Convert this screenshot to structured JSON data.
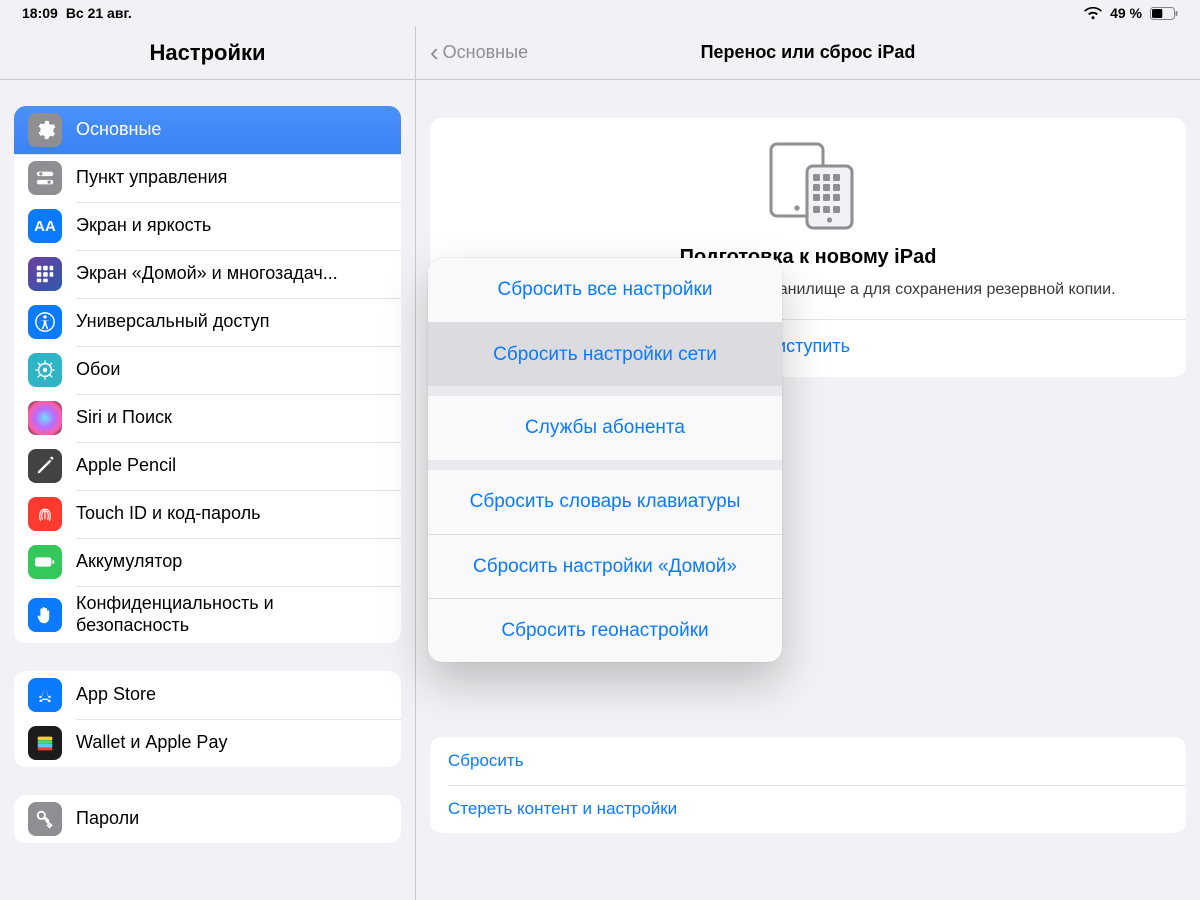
{
  "status": {
    "time": "18:09",
    "date": "Вс 21 авг.",
    "battery_text": "49 %"
  },
  "sidebar": {
    "title": "Настройки",
    "group1": [
      {
        "label": "Основные"
      },
      {
        "label": "Пункт управления"
      },
      {
        "label": "Экран и яркость"
      },
      {
        "label": "Экран «Домой» и многозадач..."
      },
      {
        "label": "Универсальный доступ"
      },
      {
        "label": "Обои"
      },
      {
        "label": "Siri и Поиск"
      },
      {
        "label": "Apple Pencil"
      },
      {
        "label": "Touch ID и код-пароль"
      },
      {
        "label": "Аккумулятор"
      },
      {
        "label": "Конфиденциальность и безопасность"
      }
    ],
    "group2": [
      {
        "label": "App Store"
      },
      {
        "label": "Wallet и Apple Pay"
      }
    ],
    "group3": [
      {
        "label": "Пароли"
      }
    ]
  },
  "detail": {
    "back_label": "Основные",
    "title": "Перенос или сброс iPad",
    "prepare": {
      "heading": "Подготовка к новому iPad",
      "desc_suffix": "й iPad, даже если сейчас в Вашем хранилище а для сохранения резервной копии.",
      "start": "риступить"
    },
    "actions": {
      "reset": "Сбросить",
      "erase": "Стереть контент и настройки"
    }
  },
  "popover": {
    "items": [
      "Сбросить все настройки",
      "Сбросить настройки сети",
      "Службы абонента",
      "Сбросить словарь клавиатуры",
      "Сбросить настройки «Домой»",
      "Сбросить геонастройки"
    ]
  }
}
